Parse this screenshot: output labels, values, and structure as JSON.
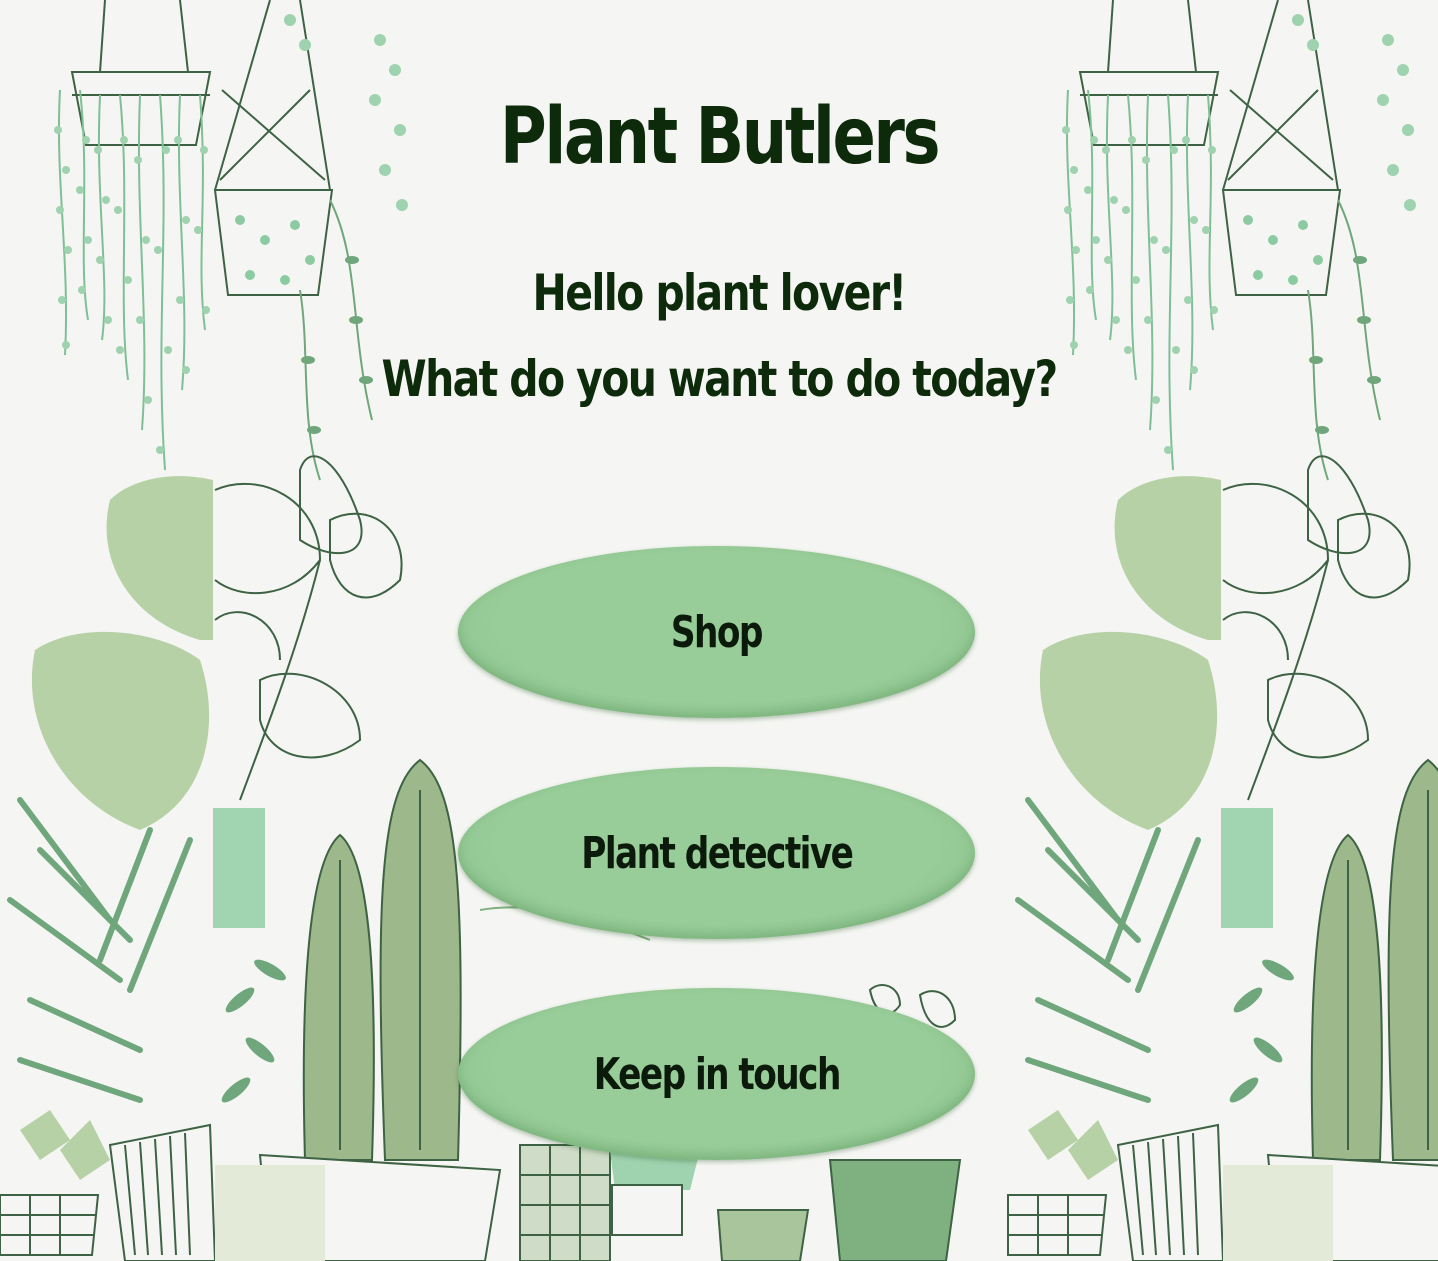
{
  "app": {
    "title": "Plant Butlers"
  },
  "greeting": {
    "line1": "Hello plant lover!",
    "line2": "What do you want to do today?"
  },
  "menu": {
    "shop_label": "Shop",
    "detective_label": "Plant detective",
    "contact_label": "Keep in touch"
  },
  "colors": {
    "background": "#f5f6f3",
    "button": "#98cc98",
    "title_text": "#0d2a0b",
    "leaf_dark": "#3f6b45",
    "leaf_light": "#9fd2ae",
    "cactus": "#9db88a"
  }
}
